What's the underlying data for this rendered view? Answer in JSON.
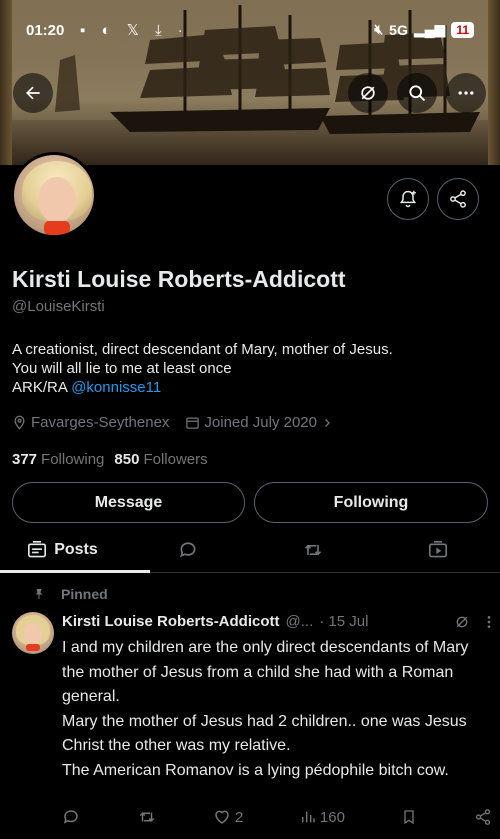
{
  "status_bar": {
    "time": "01:20",
    "network": "5G",
    "battery": "11"
  },
  "profile": {
    "display_name": "Kirsti Louise Roberts-Addicott",
    "handle": "@LouiseKirsti",
    "bio_line1": "A creationist, direct descendant of Mary, mother of Jesus.",
    "bio_line2": "You will all lie to me at least once",
    "bio_line3_prefix": "ARK/RA ",
    "bio_mention": "@konnisse11",
    "location": "Favarges-Seythenex",
    "joined": "Joined July 2020",
    "following_count": "377",
    "following_label": "Following",
    "followers_count": "850",
    "followers_label": "Followers"
  },
  "buttons": {
    "message": "Message",
    "following": "Following"
  },
  "tabs": [
    {
      "label": "Posts",
      "icon": "posts-icon",
      "active": true
    },
    {
      "label": "",
      "icon": "reply-icon",
      "active": false
    },
    {
      "label": "",
      "icon": "repost-icon",
      "active": false
    },
    {
      "label": "",
      "icon": "media-icon",
      "active": false
    }
  ],
  "post": {
    "pinned_label": "Pinned",
    "author": "Kirsti Louise Roberts-Addicott",
    "handle_trunc": "@...",
    "date": "· 15 Jul",
    "lines": [
      "I and my children are the only direct descendants of Mary the mother of Jesus from a child she had with a Roman general.",
      "Mary the mother of Jesus had 2 children.. one was Jesus Christ the other was my relative.",
      "The American Romanov is a lying pédophile bitch cow."
    ],
    "likes": "2",
    "views": "160"
  },
  "colors": {
    "background": "#000000",
    "text": "#e7e9ea",
    "muted": "#71767b",
    "link": "#1d9bf0",
    "border": "#536471"
  }
}
